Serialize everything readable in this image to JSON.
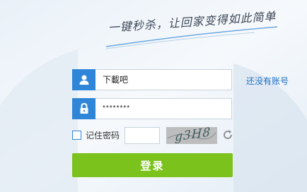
{
  "slogan": "一键秒杀，让回家变得如此简单",
  "username": {
    "value": "下載吧",
    "icon": "user-icon"
  },
  "password": {
    "value": "********",
    "icon": "lock-icon"
  },
  "register_link": "还没有账号",
  "remember": {
    "label": "记住密码",
    "checked": false
  },
  "captcha": {
    "input_value": "",
    "image_text": "g3H8",
    "refresh_icon": "refresh-icon"
  },
  "login_button": "登录",
  "colors": {
    "accent": "#2f86d8",
    "login": "#7cc21d",
    "link": "#1f6fc4"
  }
}
